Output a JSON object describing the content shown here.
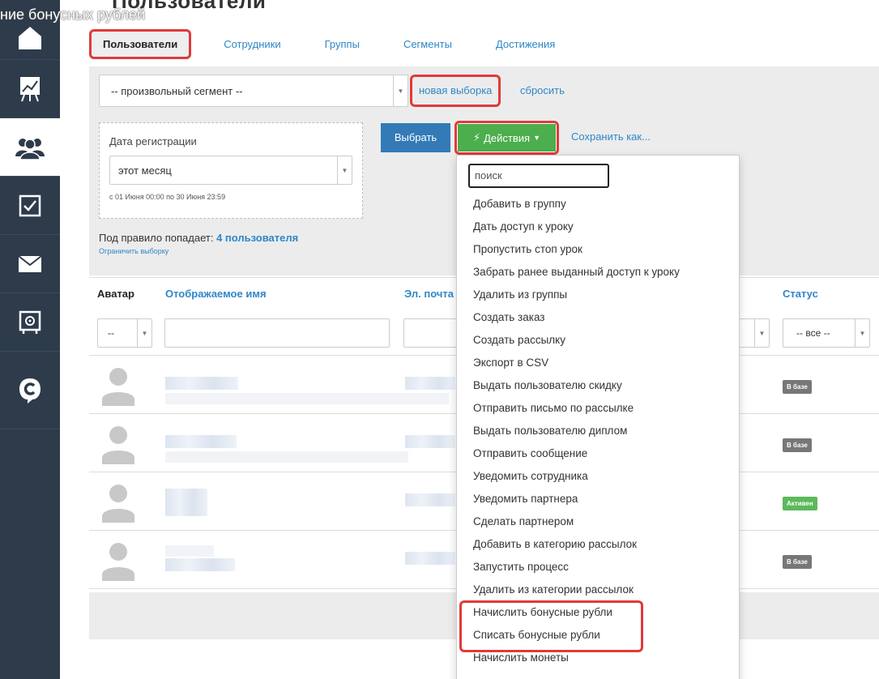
{
  "overlay_text": "ние бонусных рублей",
  "page_title": "Пользователи",
  "tabs": [
    {
      "label": "Пользователи"
    },
    {
      "label": "Сотрудники"
    },
    {
      "label": "Группы"
    },
    {
      "label": "Сегменты"
    },
    {
      "label": "Достижения"
    }
  ],
  "filter": {
    "segment_value": "-- произвольный сегмент --",
    "new_selection": "новая выборка",
    "reset": "сбросить",
    "date_label": "Дата регистрации",
    "date_value": "этот месяц",
    "date_range": "с 01 Июня 00:00 по 30 Июня 23:59",
    "choose_button": "Выбрать",
    "actions_button": "Действия",
    "save_as": "Сохранить как...",
    "rule_text": "Под правило попадает:",
    "rule_count": "4 пользователя",
    "limit_link": "Ограничить выборку"
  },
  "table": {
    "headers": {
      "avatar": "Аватар",
      "name": "Отображаемое имя",
      "email": "Эл. почта",
      "status": "Статус"
    },
    "filters": {
      "avatar_value": "--",
      "status_value": "-- все --"
    },
    "rows": [
      {
        "status": "В базе"
      },
      {
        "status": "В базе"
      },
      {
        "status": "Активен"
      },
      {
        "status": "В базе"
      }
    ]
  },
  "dropdown": {
    "search_placeholder": "поиск",
    "items": [
      "Добавить в группу",
      "Дать доступ к уроку",
      "Пропустить стоп урок",
      "Забрать ранее выданный доступ к уроку",
      "Удалить из группы",
      "Создать заказ",
      "Создать рассылку",
      "Экспорт в CSV",
      "Выдать пользователю скидку",
      "Отправить письмо по рассылке",
      "Выдать пользователю диплом",
      "Отправить сообщение",
      "Уведомить сотрудника",
      "Уведомить партнера",
      "Сделать партнером",
      "Добавить в категорию рассылок",
      "Запустить процесс",
      "Удалить из категории рассылок",
      "Начислить бонусные рубли",
      "Списать бонусные рубли",
      "Начислить монеты"
    ]
  },
  "colors": {
    "sidebar": "#2d3b4b",
    "link": "#2e87c8",
    "highlight": "#e03a3a",
    "actions_green": "#4cae4c",
    "choose_blue": "#337ab7",
    "badge_gray": "#777777",
    "badge_green": "#5cb85c"
  },
  "icons": {
    "sidebar": [
      "home-icon",
      "chart-icon",
      "users-icon",
      "checkbox-icon",
      "mail-icon",
      "safe-icon",
      "logo-icon"
    ]
  }
}
